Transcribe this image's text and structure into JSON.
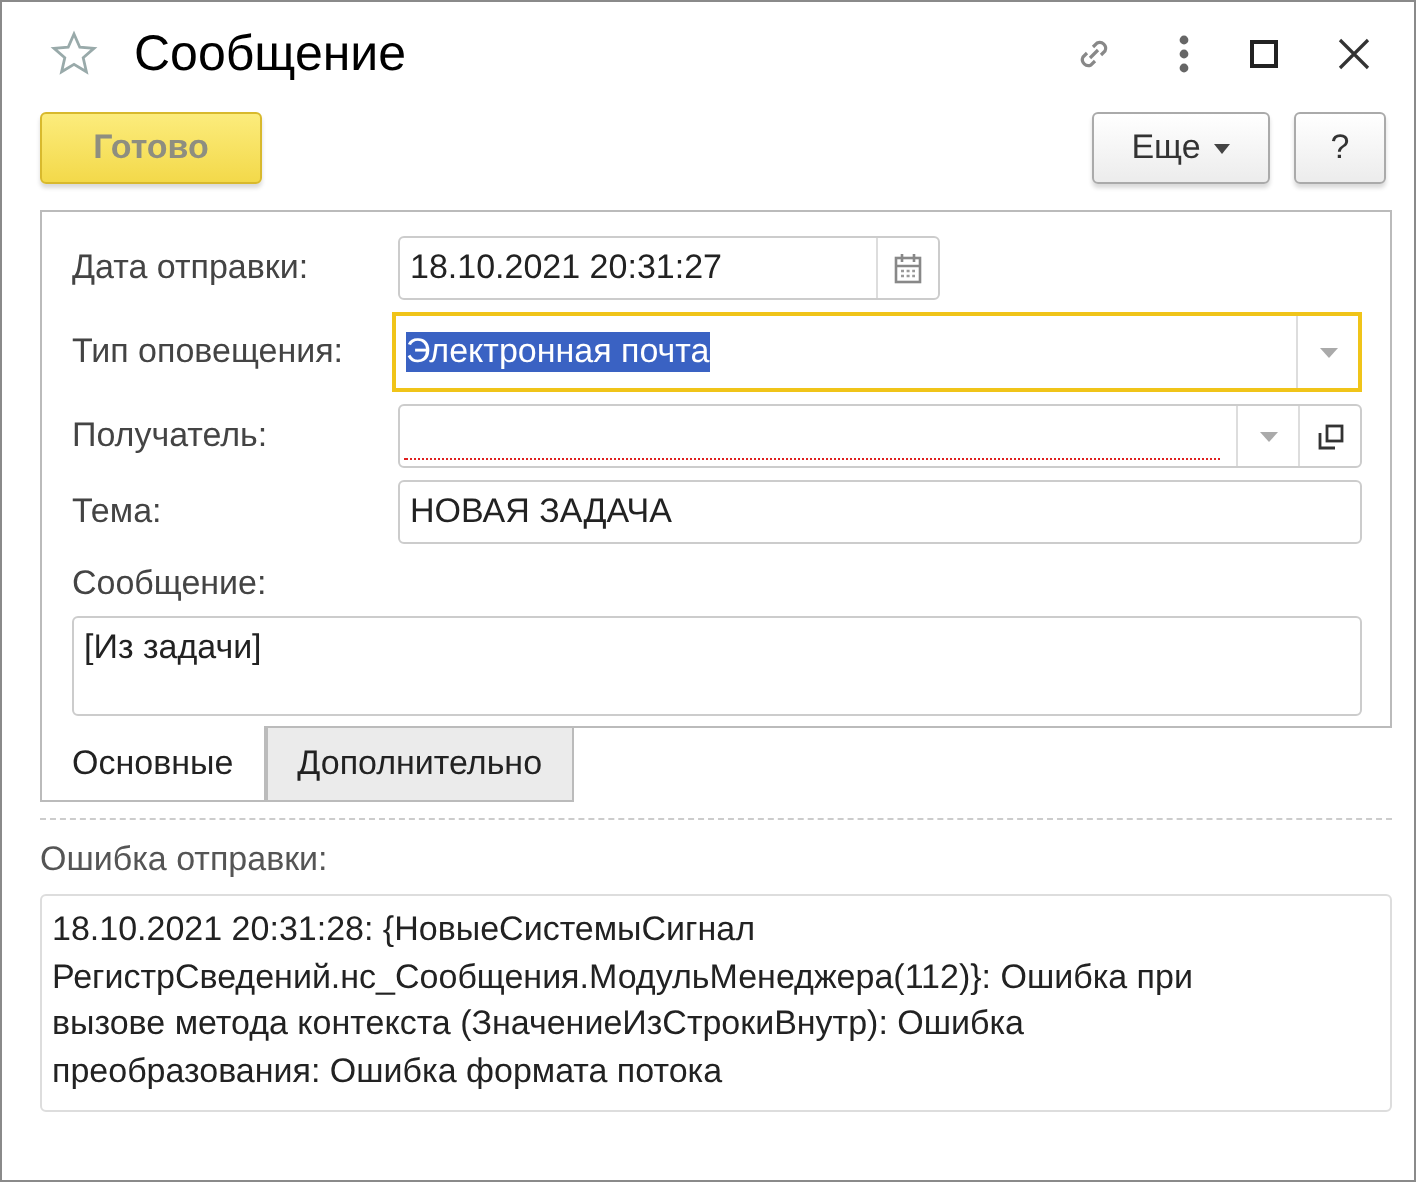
{
  "window": {
    "title": "Сообщение",
    "favorite": false
  },
  "toolbar": {
    "buttons": [
      {
        "label": "Готово",
        "kind": "primary",
        "disabled": true
      }
    ],
    "more": {
      "label": "Еще"
    },
    "help": {
      "label": "?"
    }
  },
  "form": {
    "fields": [
      {
        "label": "Дата отправки:",
        "kind": "date",
        "value": "18.10.2021 20:31:27",
        "focused": false
      },
      {
        "label": "Тип оповещения:",
        "kind": "select",
        "value": "Электронная почта",
        "focused": true
      },
      {
        "label": "Получатель:",
        "kind": "select_open",
        "focused": false,
        "required_empty": true
      },
      {
        "label": "Тема:",
        "kind": "text",
        "value": "НОВАЯ ЗАДАЧА",
        "focused": false
      },
      {
        "label": "Сообщение:",
        "kind": "textarea",
        "value": "[Из задачи]",
        "focused": false
      }
    ]
  },
  "tabs": [
    {
      "label": "Основные",
      "selected": true
    },
    {
      "label": "Дополнительно",
      "selected": false
    }
  ],
  "error": {
    "label": "Ошибка отправки:",
    "text": "18.10.2021 20:31:28: {НовыеСистемыСигнал\nРегистрСведений.нс_Сообщения.МодульМенеджера(112)}: Ошибка при\nвызове метода контекста (ЗначениеИзСтрокиВнутр): Ошибка\nпреобразования: Ошибка формата потока"
  }
}
